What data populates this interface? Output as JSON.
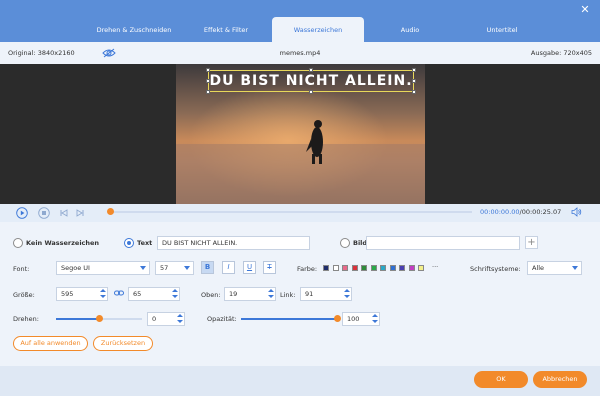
{
  "tabs": [
    {
      "label": "Drehen & Zuschneiden",
      "active": false
    },
    {
      "label": "Effekt & Filter",
      "active": false
    },
    {
      "label": "Wasserzeichen",
      "active": true
    },
    {
      "label": "Audio",
      "active": false
    },
    {
      "label": "Untertitel",
      "active": false
    }
  ],
  "window": {
    "close_icon": "close-icon"
  },
  "info": {
    "original": "Original: 3840x2160",
    "filename": "memes.mp4",
    "output": "Ausgabe: 720x405"
  },
  "preview": {
    "watermark_text": "DU BIST NICHT ALLEIN.",
    "scene": "penguin-on-beach-at-sunset"
  },
  "playback": {
    "current": "00:00:00.00",
    "total": "/00:00:25.07",
    "progress": 0.0
  },
  "watermark": {
    "none_label": "Kein Wasserzeichen",
    "text_label": "Text",
    "text_value": "DU BIST NICHT ALLEIN.",
    "image_label": "Bild",
    "image_value": "",
    "selected": "text"
  },
  "font": {
    "label": "Font:",
    "family": "Segoe UI",
    "size": "57",
    "bold_label": "B",
    "italic_label": "I",
    "underline_label": "U",
    "strike_label": "T",
    "bold_on": true,
    "color_label": "Farbe:",
    "colors": [
      "#1f2d6b",
      "#ffffff",
      "#e86a8a",
      "#d9323c",
      "#2e8b3a",
      "#2aa84a",
      "#2aa7c6",
      "#2f6fd1",
      "#4a3fb0",
      "#c23fc2",
      "#f3f08a"
    ],
    "more_label": "···",
    "script_label": "Schriftsysteme:",
    "script_value": "Alle"
  },
  "size": {
    "label": "Größe:",
    "width": "595",
    "height": "65",
    "top_label": "Oben:",
    "top": "19",
    "left_label": "Link:",
    "left": "91"
  },
  "rotate": {
    "label": "Drehen:",
    "value": "0",
    "level": 0.5,
    "opacity_label": "Opazität:",
    "opacity": "100",
    "opacity_level": 1.0
  },
  "actions": {
    "apply_all": "Auf alle anwenden",
    "reset": "Zurücksetzen"
  },
  "footer": {
    "ok": "OK",
    "cancel": "Abbrechen"
  },
  "colors": {
    "accent": "#3d78d8",
    "titlebar": "#5b8ed8",
    "orange": "#f28a2a"
  }
}
